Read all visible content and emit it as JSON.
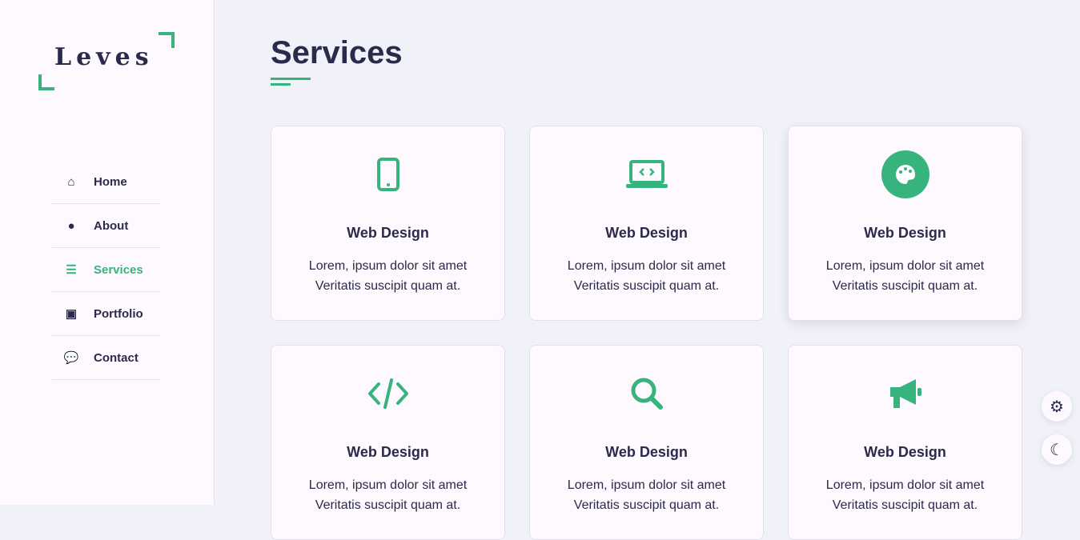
{
  "logo": "Leves",
  "nav": [
    {
      "label": "Home",
      "icon": "home-icon"
    },
    {
      "label": "About",
      "icon": "user-icon"
    },
    {
      "label": "Services",
      "icon": "list-icon",
      "active": true
    },
    {
      "label": "Portfolio",
      "icon": "briefcase-icon"
    },
    {
      "label": "Contact",
      "icon": "comments-icon"
    }
  ],
  "page_title": "Services",
  "cards": [
    {
      "icon": "mobile-icon",
      "title": "Web Design",
      "line1": "Lorem, ipsum dolor sit amet",
      "line2": "Veritatis suscipit quam at."
    },
    {
      "icon": "laptop-code-icon",
      "title": "Web Design",
      "line1": "Lorem, ipsum dolor sit amet",
      "line2": "Veritatis suscipit quam at."
    },
    {
      "icon": "palette-icon",
      "title": "Web Design",
      "line1": "Lorem, ipsum dolor sit amet",
      "line2": "Veritatis suscipit quam at."
    },
    {
      "icon": "code-icon",
      "title": "Web Design",
      "line1": "Lorem, ipsum dolor sit amet",
      "line2": "Veritatis suscipit quam at."
    },
    {
      "icon": "search-icon",
      "title": "Web Design",
      "line1": "Lorem, ipsum dolor sit amet",
      "line2": "Veritatis suscipit quam at."
    },
    {
      "icon": "bullhorn-icon",
      "title": "Web Design",
      "line1": "Lorem, ipsum dolor sit amet",
      "line2": "Veritatis suscipit quam at."
    }
  ],
  "accent": "#37b47e"
}
